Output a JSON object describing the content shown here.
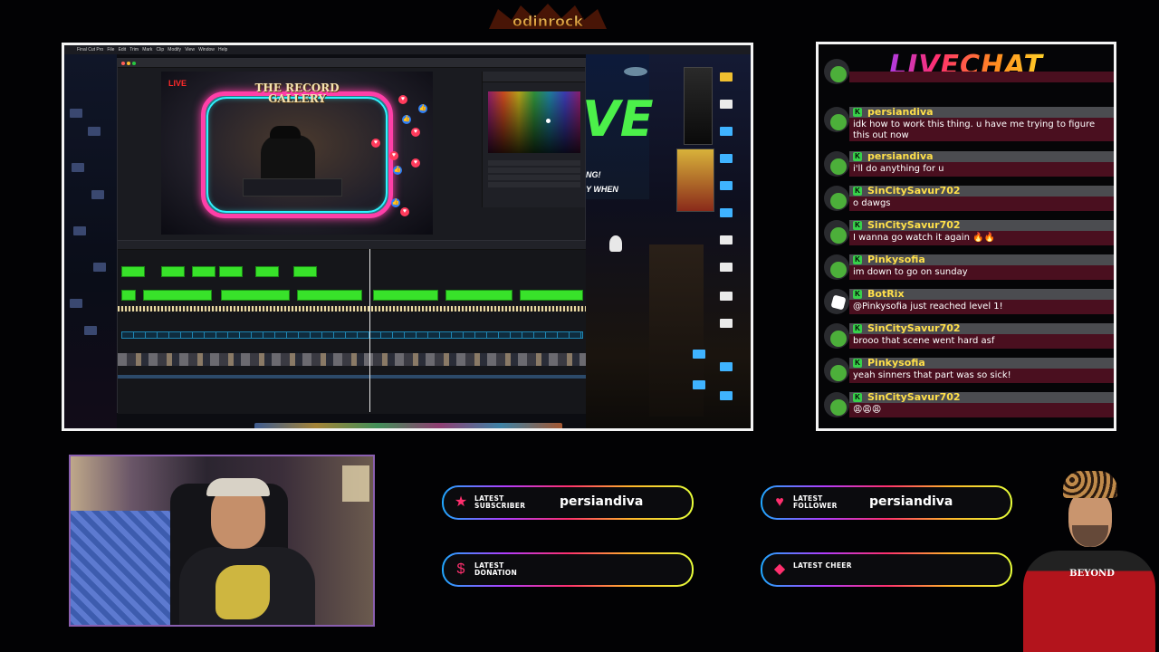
{
  "logo": {
    "text": "odinrock"
  },
  "screen": {
    "viewer": {
      "live_tag": "LIVE",
      "video_title": "THE RECORD GALLERY"
    },
    "desktop_overlay_text": "VE",
    "desktop_overlay_sub1": "NG!",
    "desktop_overlay_sub2": "Y WHEN"
  },
  "chat": {
    "title": "LIVECHAT",
    "messages": [
      {
        "user": "",
        "text": "",
        "type": "partial"
      },
      {
        "user": "persiandiva",
        "text": "idk how to work this thing. u have me trying to figure this out now",
        "type": "user"
      },
      {
        "user": "persiandiva",
        "text": "i'll do anything for u",
        "type": "user"
      },
      {
        "user": "SinCitySavur702",
        "text": "o dawgs",
        "type": "user"
      },
      {
        "user": "SinCitySavur702",
        "text": "I wanna go watch it again 🔥🔥",
        "type": "user"
      },
      {
        "user": "Pinkysofia",
        "text": "im down to go on sunday",
        "type": "user"
      },
      {
        "user": "BotRix",
        "text": "@Pinkysofia just reached level 1!",
        "type": "bot"
      },
      {
        "user": "SinCitySavur702",
        "text": "brooo that scene went hard asf",
        "type": "user"
      },
      {
        "user": "Pinkysofia",
        "text": "yeah sinners that part was so sick!",
        "type": "user"
      },
      {
        "user": "SinCitySavur702",
        "text": "😩😩😩",
        "type": "user"
      }
    ]
  },
  "alerts": {
    "subscriber": {
      "label": "LATEST SUBSCRIBER",
      "value": "persiandiva",
      "icon": "star-icon"
    },
    "follower": {
      "label": "LATEST FOLLOWER",
      "value": "persiandiva",
      "icon": "heart-icon"
    },
    "donation": {
      "label": "LATEST DONATION",
      "value": "",
      "icon": "dollar-icon"
    },
    "cheer": {
      "label": "LATEST CHEER",
      "value": "",
      "icon": "diamond-icon"
    }
  },
  "cutout": {
    "shirt_text": "BEYOND"
  },
  "colors": {
    "chat_user": "#ffe04a",
    "chat_badge": "#37d14a",
    "chat_msg_bg": "#4a0f1f",
    "frame": "#f4f4f4"
  }
}
